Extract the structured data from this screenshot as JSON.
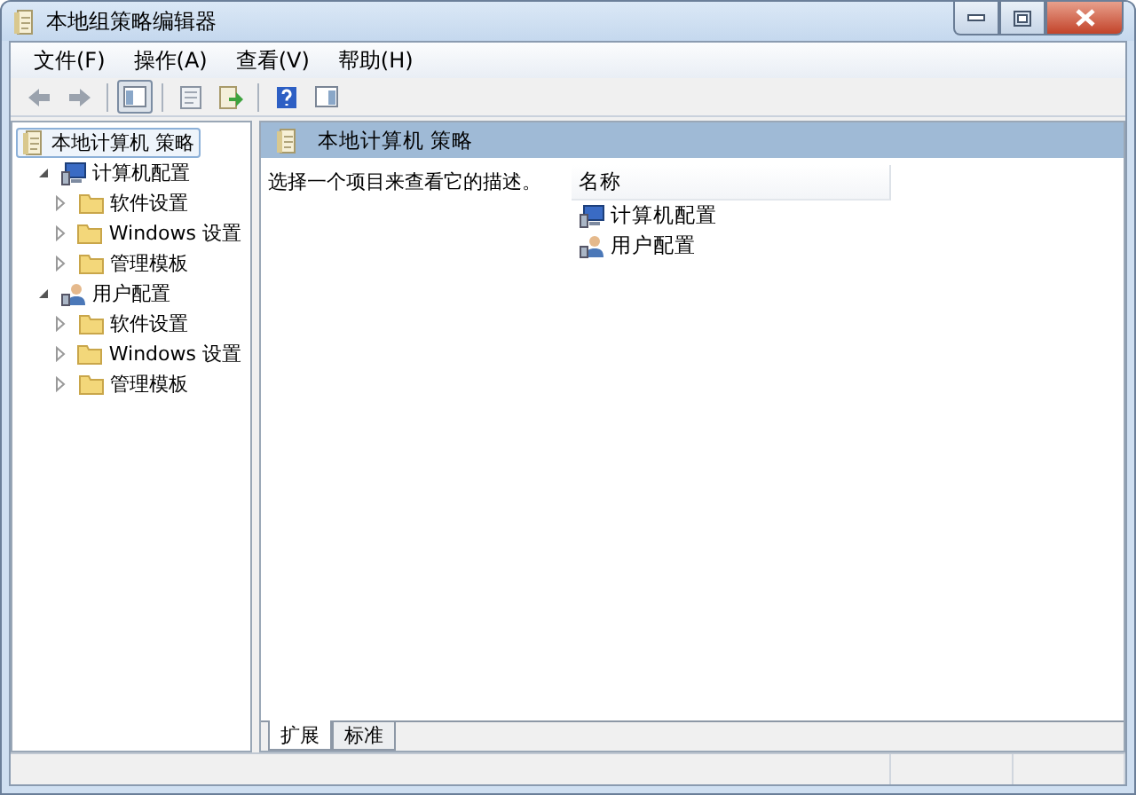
{
  "window": {
    "title": "本地组策略编辑器"
  },
  "menu": [
    "文件(F)",
    "操作(A)",
    "查看(V)",
    "帮助(H)"
  ],
  "toolbar": [
    {
      "kind": "back",
      "pressed": false
    },
    {
      "kind": "forward",
      "pressed": false
    },
    {
      "kind": "tree",
      "pressed": true
    },
    {
      "kind": "properties",
      "pressed": false
    },
    {
      "kind": "export",
      "pressed": false
    },
    {
      "kind": "help",
      "pressed": false
    },
    {
      "kind": "action-pane",
      "pressed": false
    }
  ],
  "tree": [
    {
      "label": "本地计算机 策略",
      "kind": "policy",
      "selected": true,
      "children": [
        {
          "label": "计算机配置",
          "kind": "computer",
          "selected": false,
          "expanded": true,
          "children": [
            {
              "label": "软件设置",
              "kind": "folder",
              "selected": false,
              "expanded": false
            },
            {
              "label": "Windows 设置",
              "kind": "folder",
              "selected": false,
              "expanded": false
            },
            {
              "label": "管理模板",
              "kind": "folder",
              "selected": false,
              "expanded": false
            }
          ]
        },
        {
          "label": "用户配置",
          "kind": "user",
          "selected": false,
          "expanded": true,
          "children": [
            {
              "label": "软件设置",
              "kind": "folder",
              "selected": false,
              "expanded": false
            },
            {
              "label": "Windows 设置",
              "kind": "folder",
              "selected": false,
              "expanded": false
            },
            {
              "label": "管理模板",
              "kind": "folder",
              "selected": false,
              "expanded": false
            }
          ]
        }
      ]
    }
  ],
  "detail": {
    "title": "本地计算机 策略",
    "description": "选择一个项目来查看它的描述。",
    "columns": [
      "名称"
    ],
    "rows": [
      {
        "label": "计算机配置",
        "kind": "computer"
      },
      {
        "label": "用户配置",
        "kind": "user"
      }
    ]
  },
  "tabs": [
    {
      "label": "扩展",
      "selected": true
    },
    {
      "label": "标准",
      "selected": false
    }
  ]
}
